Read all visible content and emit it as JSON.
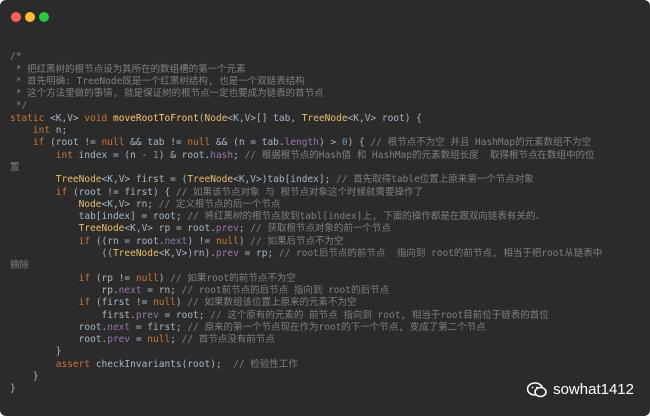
{
  "window": {
    "controls": [
      "close",
      "minimize",
      "zoom"
    ]
  },
  "code": {
    "lines": [
      "",
      "/*",
      " * 把红黑树的根节点设为其所在的数组槽的第一个元素",
      " * 首先明确: TreeNode既是一个红黑树结构, 也是一个双链表结构",
      " * 这个方法里做的事情, 就是保证树的根节点一定也要成为链表的首节点",
      " */",
      "static <K,V> void moveRootToFront(Node<K,V>[] tab, TreeNode<K,V> root) {",
      "    int n;",
      "    if (root != null && tab != null && (n = tab.length) > 0) { // 根节点不为空 并且 HashMap的元素数组不为空",
      "        int index = (n - 1) & root.hash; // 根据根节点的Hash值 和 HashMap的元素数组长度  取得根节点在数组中的位",
      "置",
      "        TreeNode<K,V> first = (TreeNode<K,V>)tab[index]; // 首先取得table位置上原来第一个节点对象",
      "        if (root != first) { // 如果该节点对象 与 根节点对象这个时候就需要操作了",
      "            Node<K,V> rn; // 定义根节点的后一个节点",
      "            tab[index] = root; // 将红黑树的根节点放到tabl[index]上, 下面的操作都是在跟双向链表有关的、",
      "            TreeNode<K,V> rp = root.prev; // 获取根节点对象的前一个节点",
      "            if ((rn = root.next) != null) // 如果后节点不为空",
      "                ((TreeNode<K,V>)rn).prev = rp; // root后节点的前节点  指向到 root的前节点, 相当于把root从链表中",
      "摘除",
      "            if (rp != null) // 如果root的前节点不为空",
      "                rp.next = rn; // root前节点的后节点 指向到 root的后节点",
      "            if (first != null) // 如果数组该位置上原来的元素不为空",
      "                first.prev = root; // 这个原有的元素的 前节点 指向到 root, 相当于root目前位于链表的首位",
      "            root.next = first; // 原来的第一个节点现在作为root的下一个节点, 变成了第二个节点",
      "            root.prev = null; // 首节点没有前节点",
      "        }",
      "        assert checkInvariants(root);  // 检验性工作",
      "    }",
      "}"
    ]
  },
  "watermark": {
    "text": "sowhat1412",
    "icon": "wechat-icon"
  }
}
